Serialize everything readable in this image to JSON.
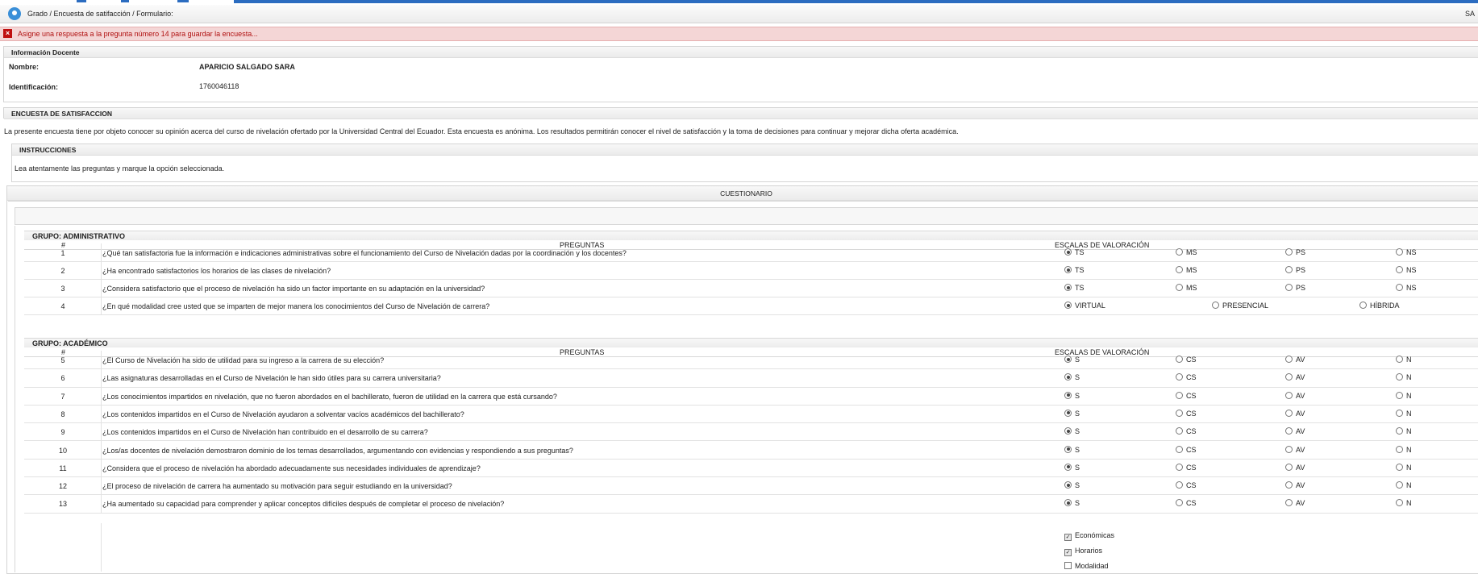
{
  "breadcrumb": "Grado / Encuesta de satifacción / Formulario:",
  "header_right": "SA",
  "alert": "Asigne una respuesta a la pregunta número 14 para guardar la encuesta...",
  "docente": {
    "title": "Información Docente",
    "nombre_label": "Nombre:",
    "nombre": "APARICIO SALGADO SARA",
    "id_label": "Identificación:",
    "id": "1760046118"
  },
  "encuesta": {
    "title": "ENCUESTA DE SATISFACCION",
    "description": "La presente encuesta tiene por objeto conocer su opinión acerca del curso de nivelación ofertado por la Universidad Central del Ecuador. Esta encuesta es anónima. Los resultados permitirán conocer el nivel de satisfacción y la toma de decisiones para continuar y mejorar dicha oferta académica."
  },
  "instrucciones": {
    "title": "INSTRUCCIONES",
    "text": "Lea atentamente las preguntas y marque la opción seleccionada."
  },
  "cuestionario": "CUESTIONARIO",
  "groups": [
    {
      "title": "GRUPO: ADMINISTRATIVO",
      "col_num": "#",
      "col_q": "PREGUNTAS",
      "col_scale": "ESCALAS DE VALORACIÓN",
      "rows": [
        {
          "n": "1",
          "q": "¿Qué tan satisfactoria fue la información e indicaciones administrativas sobre el funcionamiento del Curso de Nivelación dadas por la coordinación y los docentes?",
          "options": [
            "TS",
            "MS",
            "PS",
            "NS"
          ],
          "selected": 0
        },
        {
          "n": "2",
          "q": "¿Ha encontrado satisfactorios los horarios de las clases de nivelación?",
          "options": [
            "TS",
            "MS",
            "PS",
            "NS"
          ],
          "selected": 0
        },
        {
          "n": "3",
          "q": "¿Considera satisfactorio que el proceso de nivelación ha sido un factor importante en su adaptación en la universidad?",
          "options": [
            "TS",
            "MS",
            "PS",
            "NS"
          ],
          "selected": 0
        },
        {
          "n": "4",
          "q": "¿En qué modalidad cree usted que se imparten de mejor manera los conocimientos del Curso de Nivelación de carrera?",
          "options": [
            "VIRTUAL",
            "PRESENCIAL",
            "HÍBRIDA"
          ],
          "selected": 0
        }
      ]
    },
    {
      "title": "GRUPO: ACADÉMICO",
      "col_num": "#",
      "col_q": "PREGUNTAS",
      "col_scale": "ESCALAS DE VALORACIÓN",
      "rows": [
        {
          "n": "5",
          "q": "¿El Curso de Nivelación ha sido de utilidad para su ingreso a la carrera de su elección?",
          "options": [
            "S",
            "CS",
            "AV",
            "N"
          ],
          "selected": 0
        },
        {
          "n": "6",
          "q": "¿Las asignaturas desarrolladas en el Curso de Nivelación le han sido útiles para su carrera universitaria?",
          "options": [
            "S",
            "CS",
            "AV",
            "N"
          ],
          "selected": 0
        },
        {
          "n": "7",
          "q": "¿Los conocimientos impartidos en nivelación, que no fueron abordados en el bachillerato, fueron de utilidad en la carrera que está cursando?",
          "options": [
            "S",
            "CS",
            "AV",
            "N"
          ],
          "selected": 0
        },
        {
          "n": "8",
          "q": "¿Los contenidos impartidos en el Curso de Nivelación ayudaron a solventar vacíos académicos del bachillerato?",
          "options": [
            "S",
            "CS",
            "AV",
            "N"
          ],
          "selected": 0
        },
        {
          "n": "9",
          "q": "¿Los contenidos impartidos en el Curso de Nivelación han contribuido en el desarrollo de su carrera?",
          "options": [
            "S",
            "CS",
            "AV",
            "N"
          ],
          "selected": 0
        },
        {
          "n": "10",
          "q": "¿Los/as docentes de nivelación demostraron dominio de los temas desarrollados, argumentando con evidencias y respondiendo a sus preguntas?",
          "options": [
            "S",
            "CS",
            "AV",
            "N"
          ],
          "selected": 0
        },
        {
          "n": "11",
          "q": "¿Considera que el proceso de nivelación ha abordado adecuadamente sus necesidades individuales de aprendizaje?",
          "options": [
            "S",
            "CS",
            "AV",
            "N"
          ],
          "selected": 0
        },
        {
          "n": "12",
          "q": "¿El proceso de nivelación de carrera ha aumentado su motivación para seguir estudiando en la universidad?",
          "options": [
            "S",
            "CS",
            "AV",
            "N"
          ],
          "selected": 0
        },
        {
          "n": "13",
          "q": "¿Ha aumentado su capacidad para comprender y aplicar conceptos difíciles después de completar el proceso de nivelación?",
          "options": [
            "S",
            "CS",
            "AV",
            "N"
          ],
          "selected": 0
        }
      ]
    }
  ],
  "checkboxes": [
    {
      "label": "Económicas",
      "checked": true
    },
    {
      "label": "Horarios",
      "checked": true
    },
    {
      "label": "Modalidad",
      "checked": false
    }
  ]
}
